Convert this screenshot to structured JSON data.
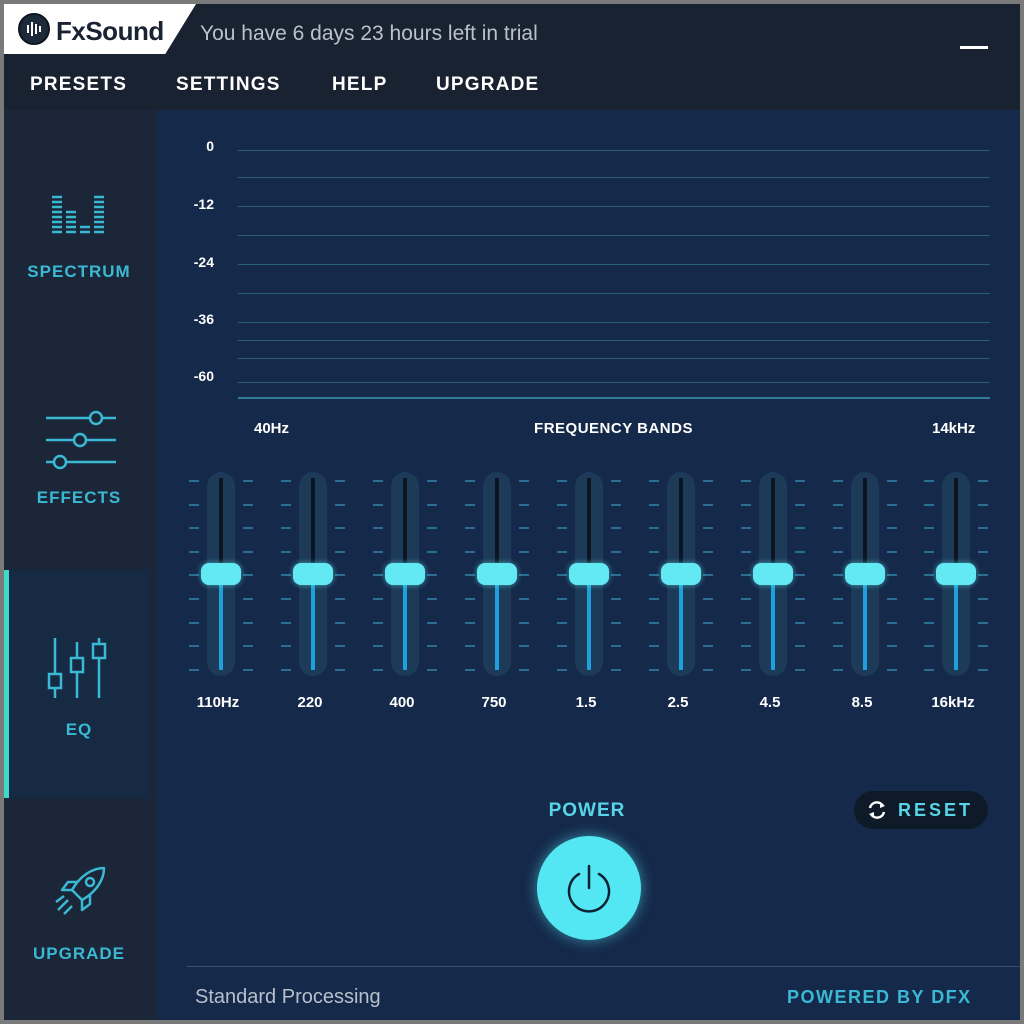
{
  "app": {
    "logo_text": "FxSound",
    "trial_text": "You have 6 days 23 hours left in trial"
  },
  "menu": {
    "presets": "PRESETS",
    "settings": "SETTINGS",
    "help": "HELP",
    "upgrade": "UPGRADE"
  },
  "sidebar": {
    "items": [
      {
        "label": "SPECTRUM",
        "icon": "spectrum-icon"
      },
      {
        "label": "EFFECTS",
        "icon": "sliders-icon"
      },
      {
        "label": "EQ",
        "icon": "eq-icon",
        "active": true
      },
      {
        "label": "UPGRADE",
        "icon": "rocket-icon"
      }
    ]
  },
  "spectrum": {
    "db_labels": [
      "0",
      "-12",
      "-24",
      "-36",
      "-60"
    ],
    "freq_low": "40Hz",
    "title": "FREQUENCY BANDS",
    "freq_high": "14kHz"
  },
  "eq": {
    "bands": [
      {
        "label": "110Hz",
        "level": 0.5
      },
      {
        "label": "220",
        "level": 0.5
      },
      {
        "label": "400",
        "level": 0.5
      },
      {
        "label": "750",
        "level": 0.5
      },
      {
        "label": "1.5",
        "level": 0.5
      },
      {
        "label": "2.5",
        "level": 0.5
      },
      {
        "label": "4.5",
        "level": 0.5
      },
      {
        "label": "8.5",
        "level": 0.5
      },
      {
        "label": "16kHz",
        "level": 0.5
      }
    ]
  },
  "controls": {
    "power_label": "POWER",
    "reset_label": "RESET"
  },
  "footer": {
    "status": "Standard Processing",
    "powered_by": "POWERED BY DFX"
  },
  "colors": {
    "accent": "#56d6e8",
    "slider_fill": "#1ea0de",
    "active_bar": "#3fd9c9",
    "background": "#15294a"
  }
}
